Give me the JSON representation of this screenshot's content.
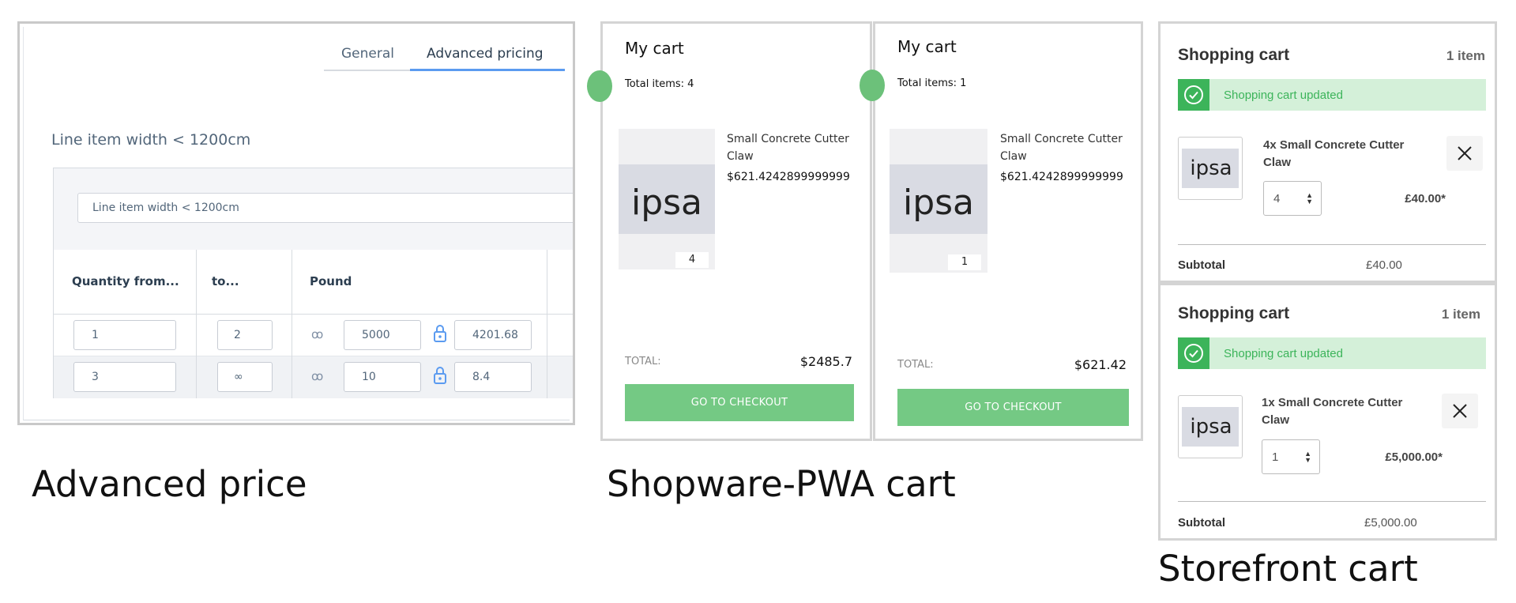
{
  "advanced_pricing": {
    "tabs": [
      "General",
      "Advanced pricing"
    ],
    "active_tab": "Advanced pricing",
    "rule_title": "Line item width < 1200cm",
    "rule_input_value": "Line item width < 1200cm",
    "columns": [
      "Quantity from...",
      "to...",
      "Pound"
    ],
    "rows": [
      {
        "from": "1",
        "to": "2",
        "gross": "5000",
        "net": "4201.68"
      },
      {
        "from": "3",
        "to": "∞",
        "gross": "10",
        "net": "8.4"
      }
    ],
    "icons": {
      "link": "unlink-icon",
      "lock": "lock-icon"
    }
  },
  "pwa_cart_1": {
    "title": "My cart",
    "total_items": "Total items: 4",
    "image_text": "ipsa",
    "quantity": "4",
    "product_name": "Small Concrete Cutter Claw",
    "product_price": "$621.4242899999999",
    "total_label": "TOTAL:",
    "total_value": "$2485.7",
    "checkout": "GO TO CHECKOUT"
  },
  "pwa_cart_2": {
    "title": "My cart",
    "total_items": "Total items: 1",
    "image_text": "ipsa",
    "quantity": "1",
    "product_name": "Small Concrete Cutter Claw",
    "product_price": "$621.4242899999999",
    "total_label": "TOTAL:",
    "total_value": "$621.42",
    "checkout": "GO TO CHECKOUT"
  },
  "storefront_cart_1": {
    "title": "Shopping cart",
    "item_count": "1 item",
    "alert": "Shopping cart updated",
    "image_text": "ipsa",
    "product_name": "4x Small Concrete Cutter Claw",
    "quantity": "4",
    "price": "£40.00*",
    "subtotal_label": "Subtotal",
    "subtotal_value": "£40.00"
  },
  "storefront_cart_2": {
    "title": "Shopping cart",
    "item_count": "1 item",
    "alert": "Shopping cart updated",
    "image_text": "ipsa",
    "product_name": "1x Small Concrete Cutter Claw",
    "quantity": "1",
    "price": "£5,000.00*",
    "subtotal_label": "Subtotal",
    "subtotal_value": "£5,000.00"
  },
  "captions": {
    "advanced": "Advanced price",
    "pwa": "Shopware-PWA cart",
    "storefront": "Storefront cart"
  },
  "colors": {
    "accent_blue": "#5b9bf0",
    "pwa_green": "#74c984",
    "success_green": "#3cb45a",
    "success_bg": "#d4f0d9"
  }
}
